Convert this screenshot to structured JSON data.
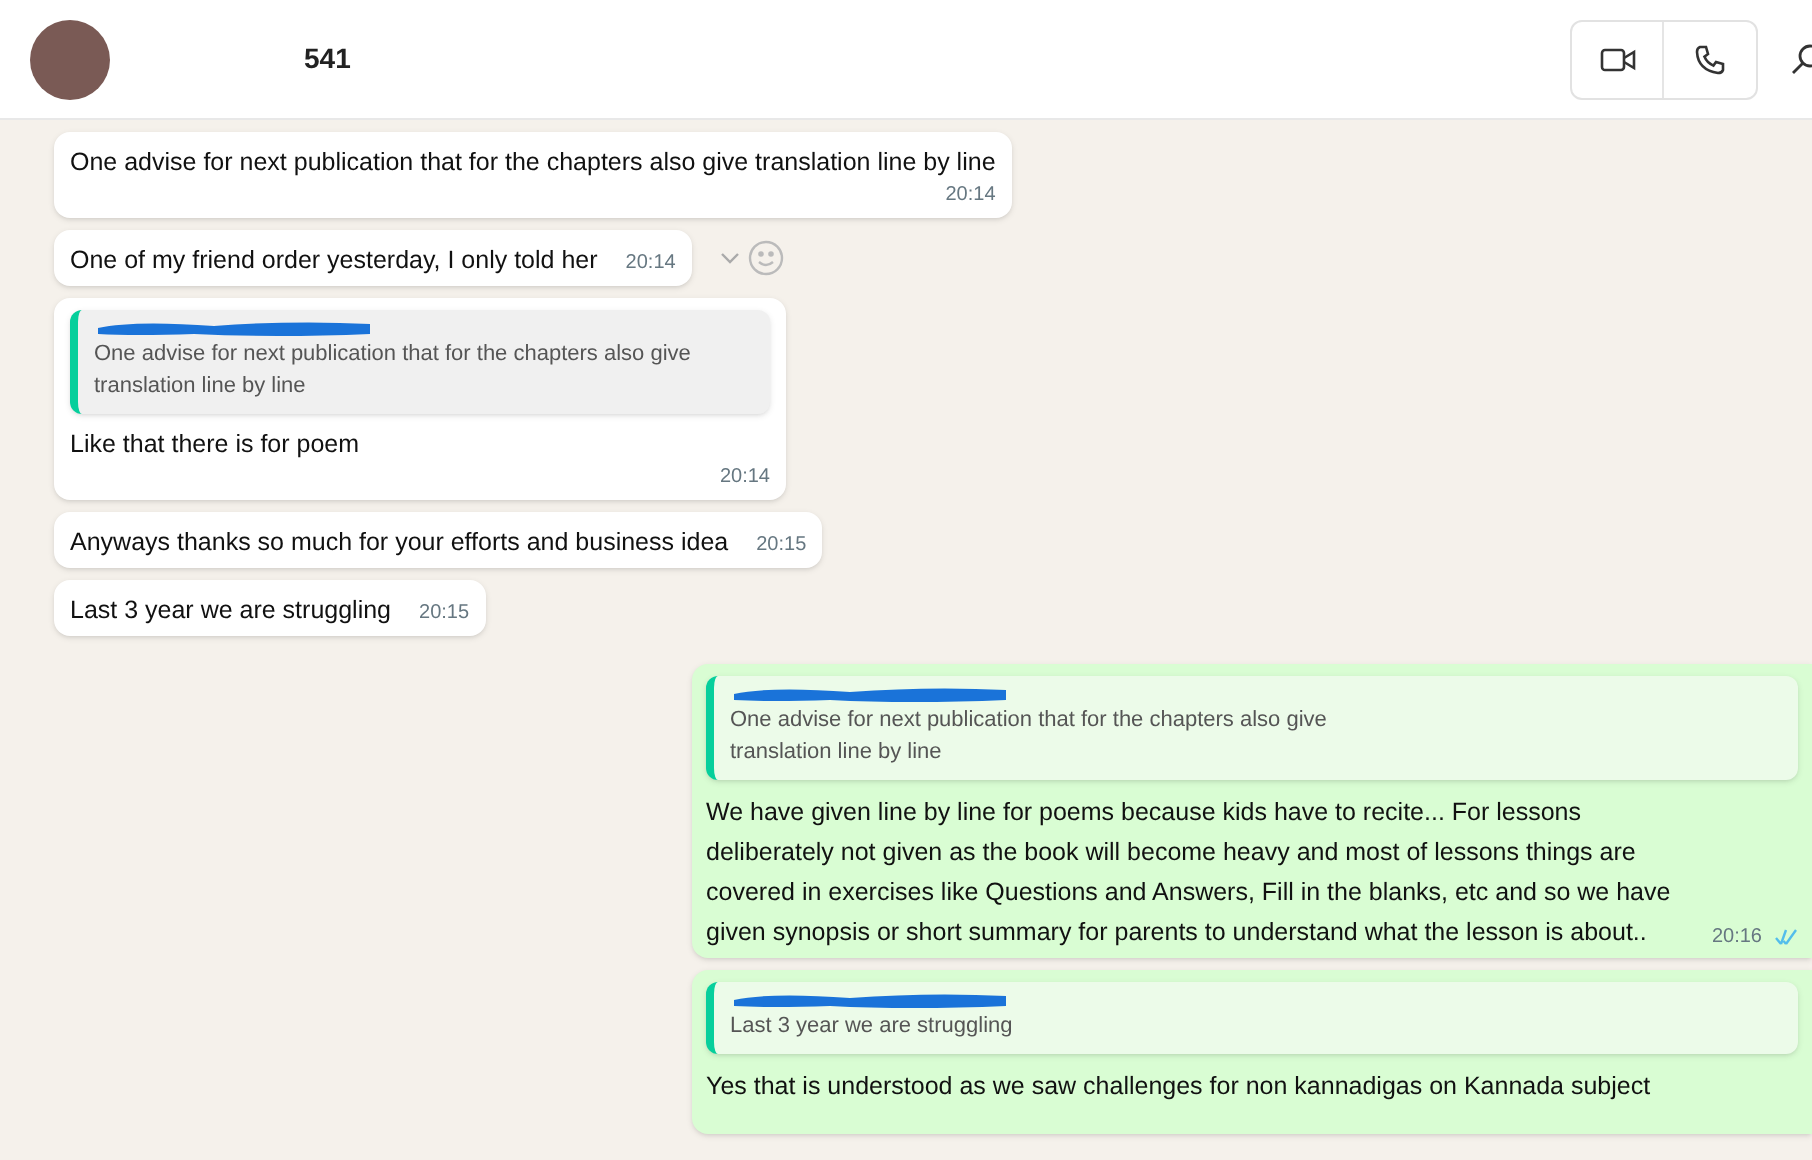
{
  "header": {
    "title": "541"
  },
  "messages": [
    {
      "outgoing": false,
      "text": "One advise for next publication that for the chapters also give translation line by line",
      "time": "20:14",
      "stacked": true
    },
    {
      "outgoing": false,
      "text": "One of my friend order yesterday, I only told her",
      "time": "20:14",
      "hovered": true
    },
    {
      "outgoing": false,
      "quote": "One advise for next publication that for the chapters also give translation line by line",
      "text": "Like that there is for poem",
      "time": "20:14",
      "stacked": true
    },
    {
      "outgoing": false,
      "text": "Anyways thanks so much for your efforts and business idea",
      "time": "20:15"
    },
    {
      "outgoing": false,
      "text": "Last 3 year we are struggling",
      "time": "20:15"
    },
    {
      "outgoing": true,
      "quote": "One advise for next publication that for the chapters also give translation line by line",
      "text": "We have given line by line for poems because kids have to recite... For lessons deliberately not given as the book will become heavy and most of lessons things are covered in exercises like Questions and Answers, Fill in the blanks, etc and so we have given synopsis or short summary for parents to understand what the lesson is about..",
      "time": "20:16",
      "read": true
    },
    {
      "outgoing": true,
      "quote": "Last 3 year we are struggling",
      "text": "Yes that is understood as we saw challenges for non kannadigas on Kannada subject"
    }
  ]
}
